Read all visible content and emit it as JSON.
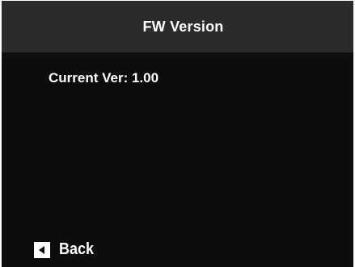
{
  "header": {
    "title": "FW Version"
  },
  "main": {
    "version_label": "Current Ver:",
    "version_value": "1.00"
  },
  "footer": {
    "back_label": "Back",
    "back_icon": "back-arrow-icon"
  },
  "colors": {
    "header_bg": "#2b2b2b",
    "screen_bg": "#0d0d0d",
    "text": "#ffffff"
  }
}
